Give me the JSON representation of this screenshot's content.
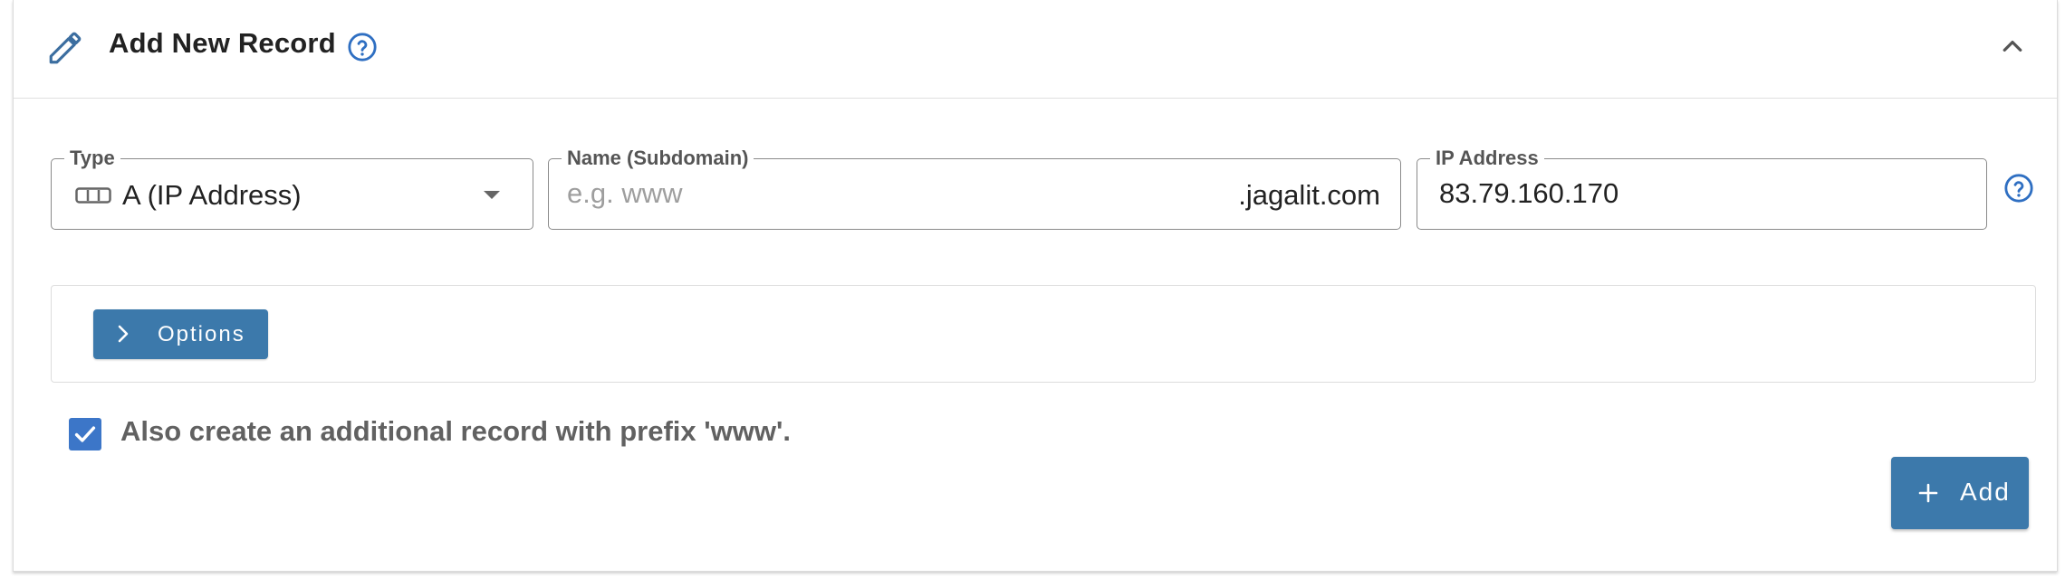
{
  "header": {
    "title": "Add New Record",
    "icon": "pencil-icon",
    "help_icon": "help-circle-icon",
    "collapse_icon": "chevron-up-icon"
  },
  "form": {
    "type": {
      "label": "Type",
      "value": "A (IP Address)",
      "icon": "ip-record-icon"
    },
    "name": {
      "label": "Name (Subdomain)",
      "placeholder": "e.g. www",
      "value": "",
      "suffix": ".jagalit.com"
    },
    "ip": {
      "label": "IP Address",
      "value": "83.79.160.170",
      "help_icon": "help-circle-icon"
    }
  },
  "options": {
    "button_label": "Options",
    "icon": "chevron-right-icon"
  },
  "www_record": {
    "checked": true,
    "label": "Also create an additional record with prefix 'www'."
  },
  "actions": {
    "add_label": "Add",
    "add_icon": "plus-icon"
  },
  "colors": {
    "primary": "#3c79ab",
    "checkbox": "#3c76c8",
    "help": "#2f6fc2",
    "border": "#8a8a8a"
  }
}
